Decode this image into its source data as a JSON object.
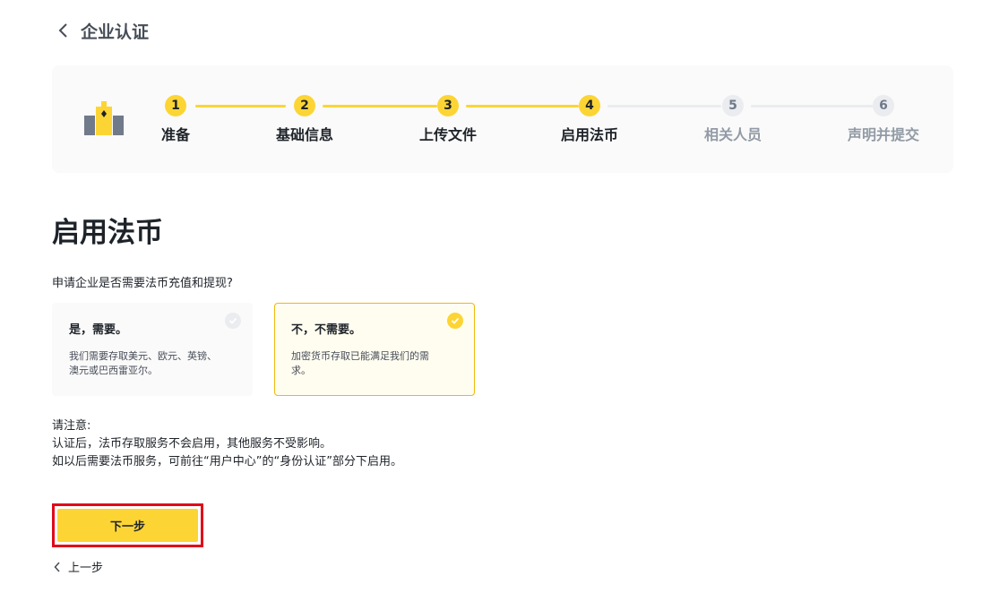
{
  "header": {
    "title": "企业认证"
  },
  "stepper": {
    "steps": [
      {
        "num": "1",
        "label": "准备",
        "status": "done"
      },
      {
        "num": "2",
        "label": "基础信息",
        "status": "done"
      },
      {
        "num": "3",
        "label": "上传文件",
        "status": "done"
      },
      {
        "num": "4",
        "label": "启用法币",
        "status": "current"
      },
      {
        "num": "5",
        "label": "相关人员",
        "status": "todo"
      },
      {
        "num": "6",
        "label": "声明并提交",
        "status": "todo"
      }
    ]
  },
  "section": {
    "title": "启用法币",
    "question": "申请企业是否需要法币充值和提现?"
  },
  "options": [
    {
      "title": "是，需要。",
      "desc_line1": "我们需要存取美元、欧元、英镑、",
      "desc_line2": "澳元或巴西雷亚尔。",
      "selected": false
    },
    {
      "title": "不，不需要。",
      "desc_line1": "加密货币存取已能满足我们的需",
      "desc_line2": "求。",
      "selected": true
    }
  ],
  "notes": {
    "line1": "请注意:",
    "line2": "认证后，法币存取服务不会启用，其他服务不受影响。",
    "line3": "如以后需要法币服务，可前往“用户中心”的“身份认证”部分下启用。"
  },
  "actions": {
    "next_label": "下一步",
    "prev_label": "上一步"
  },
  "colors": {
    "accent": "#fcd535",
    "selected_border": "#f0b90b",
    "highlight_border": "#e0081a",
    "inactive": "#eaecef"
  },
  "icons": {
    "back": "chevron-left-icon",
    "check": "check-circle-icon",
    "logo": "building-icon"
  }
}
